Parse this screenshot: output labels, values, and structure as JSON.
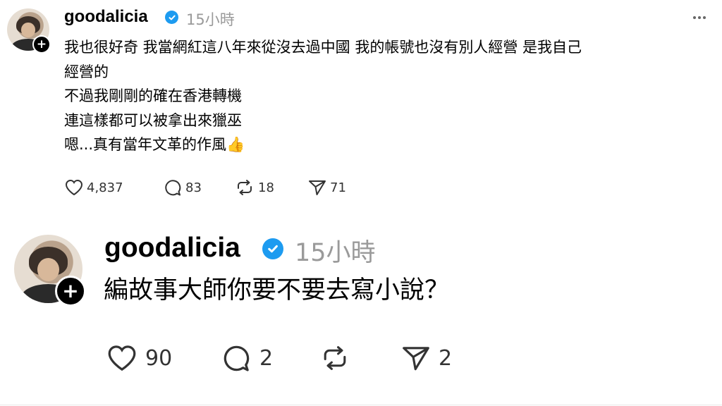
{
  "post1": {
    "username": "goodalicia",
    "time": "15小時",
    "text": "我也很好奇 我當網紅這八年來從沒去過中國 我的帳號也沒有別人經營 是我自己\n經營的\n不過我剛剛的確在香港轉機\n連這樣都可以被拿出來獵巫\n嗯...真有當年文革的作風👍",
    "likes": "4,837",
    "comments": "83",
    "reposts": "18",
    "shares": "71"
  },
  "post2": {
    "username": "goodalicia",
    "time": "15小時",
    "text": "編故事大師你要不要去寫小說？",
    "likes": "90",
    "comments": "2",
    "reposts": "",
    "shares": "2"
  },
  "icons": {
    "like": "heart-icon",
    "comment": "comment-icon",
    "repost": "repost-icon",
    "share": "share-icon",
    "more": "more-options-icon",
    "verified": "verified-badge-icon",
    "follow": "follow-plus-icon"
  },
  "colors": {
    "verified": "#1d9bf0",
    "timestamp": "#9a9a9a"
  }
}
